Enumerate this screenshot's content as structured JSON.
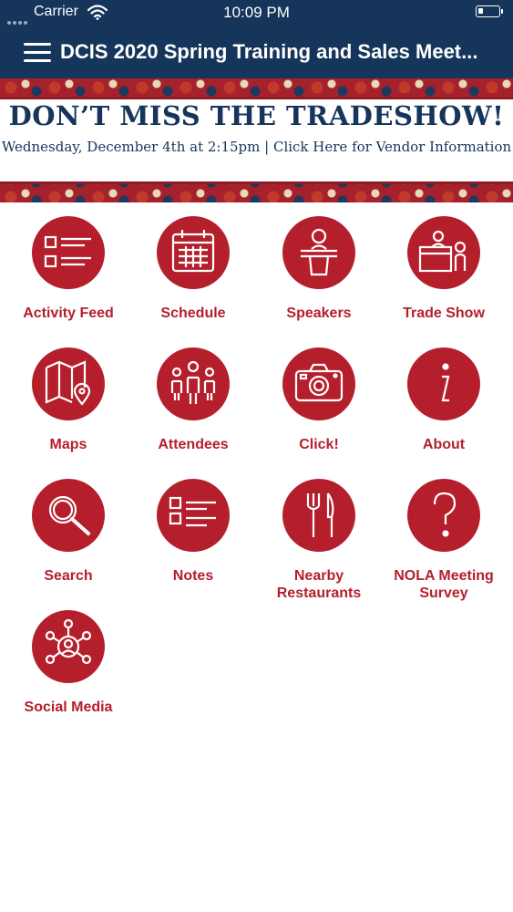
{
  "status_bar": {
    "carrier": "Carrier",
    "time": "10:09 PM"
  },
  "nav": {
    "title": "DCIS 2020 Spring Training and Sales Meet..."
  },
  "banner": {
    "headline": "DON’T MISS THE TRADESHOW!",
    "subline": "Wednesday, December 4th at 2:15pm  |  Click Here for Vendor Information"
  },
  "tiles": [
    {
      "label": "Activity Feed",
      "icon": "activity-feed-icon"
    },
    {
      "label": "Schedule",
      "icon": "calendar-icon"
    },
    {
      "label": "Speakers",
      "icon": "speaker-podium-icon"
    },
    {
      "label": "Trade Show",
      "icon": "trade-show-booth-icon"
    },
    {
      "label": "Maps",
      "icon": "map-icon"
    },
    {
      "label": "Attendees",
      "icon": "people-icon"
    },
    {
      "label": "Click!",
      "icon": "camera-icon"
    },
    {
      "label": "About",
      "icon": "info-icon"
    },
    {
      "label": "Search",
      "icon": "search-icon"
    },
    {
      "label": "Notes",
      "icon": "notes-list-icon"
    },
    {
      "label": "Nearby Restaurants",
      "icon": "fork-knife-icon"
    },
    {
      "label": "NOLA Meeting Survey",
      "icon": "question-icon"
    },
    {
      "label": "Social Media",
      "icon": "social-network-icon"
    }
  ],
  "colors": {
    "nav": "#15355a",
    "accent": "#b51f2c"
  }
}
